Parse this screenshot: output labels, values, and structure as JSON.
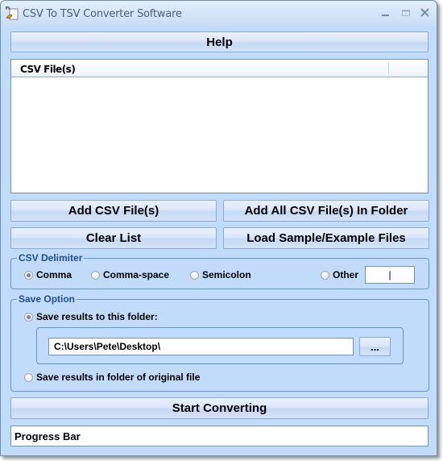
{
  "window": {
    "title": "CSV To TSV Converter Software",
    "controls": [
      "minimize",
      "maximize",
      "close"
    ]
  },
  "buttons": {
    "help": "Help",
    "add_files": "Add CSV File(s)",
    "add_folder": "Add All CSV File(s) In Folder",
    "clear_list": "Clear List",
    "load_samples": "Load Sample/Example Files",
    "browse": "...",
    "start": "Start Converting"
  },
  "file_list": {
    "column_header": "CSV File(s)",
    "items": []
  },
  "delimiter": {
    "legend": "CSV Delimiter",
    "options": [
      {
        "label": "Comma",
        "checked": true
      },
      {
        "label": "Comma-space",
        "checked": false
      },
      {
        "label": "Semicolon",
        "checked": false
      },
      {
        "label": "Other",
        "checked": false
      }
    ],
    "other_value": "|"
  },
  "save": {
    "legend": "Save Option",
    "option_folder": "Save results to this folder:",
    "option_folder_checked": true,
    "folder_path": "C:\\Users\\Pete\\Desktop\\",
    "option_original": "Save results in folder of original file",
    "option_original_checked": false
  },
  "progress": {
    "label": "Progress Bar"
  }
}
